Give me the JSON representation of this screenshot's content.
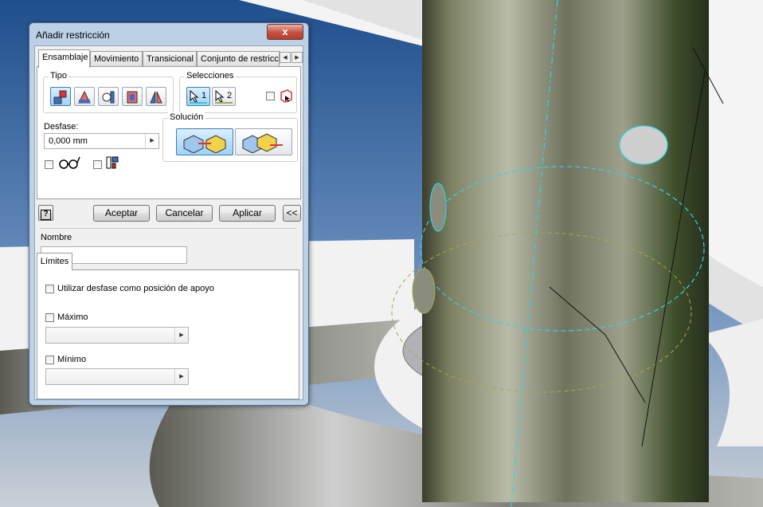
{
  "window": {
    "title": "Añadir restricción",
    "close_label": "x"
  },
  "tabs": [
    "Ensamblaje",
    "Movimiento",
    "Transicional",
    "Conjunto de restricc"
  ],
  "tab_scroll": {
    "left": "◀",
    "right": "▶"
  },
  "tipo": {
    "label": "Tipo"
  },
  "selecciones": {
    "label": "Selecciones",
    "sel1": "1",
    "sel2": "2"
  },
  "desfase": {
    "label": "Desfase:",
    "value": "0,000 mm",
    "arrow": "▶"
  },
  "solucion": {
    "label": "Solución"
  },
  "buttons": {
    "help": "?",
    "ok": "Aceptar",
    "cancel": "Cancelar",
    "apply": "Aplicar",
    "collapse": "<<"
  },
  "nombre": {
    "label": "Nombre",
    "value": ""
  },
  "limites": {
    "tab": "Límites",
    "use_offset": "Utilizar desfase como posición de apoyo",
    "max_label": "Máximo",
    "min_label": "Mínimo",
    "arrow": "▶"
  },
  "colors": {
    "dialog_frame": "#bcd0e6",
    "selected_button": "#9fd2f8",
    "viewport_sky": "#2f5f98",
    "cyan_edge": "#32d2e6"
  }
}
